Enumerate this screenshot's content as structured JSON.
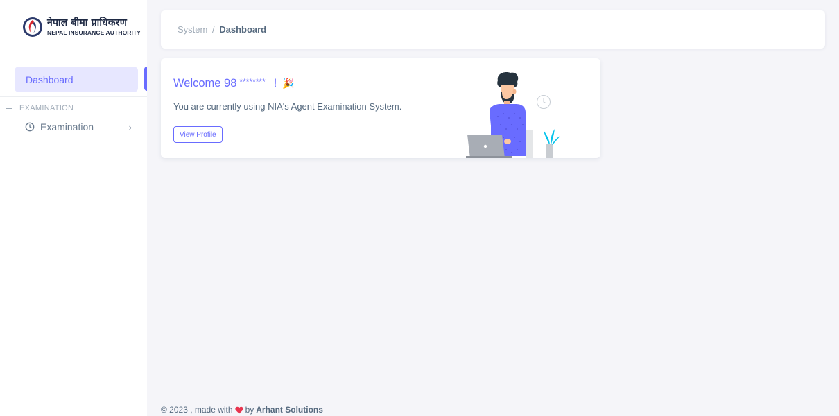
{
  "brand": {
    "name_devanagari": "नेपाल बीमा प्राधिकरण",
    "name_english": "NEPAL INSURANCE AUTHORITY"
  },
  "sidebar": {
    "active_item": "Dashboard",
    "section_header": "EXAMINATION",
    "items": [
      {
        "label": "Examination",
        "icon": "clock-icon"
      }
    ]
  },
  "breadcrumb": {
    "parent": "System",
    "separator": "/",
    "current": "Dashboard"
  },
  "welcome_card": {
    "greeting": "Welcome 98",
    "masked": "********",
    "exclaim": "!",
    "emoji": "🎉",
    "message": "You are currently using NIA's Agent Examination System.",
    "button_label": "View Profile"
  },
  "footer": {
    "copyright": "© 2023 , made with",
    "by": "by",
    "company": "Arhant Solutions"
  },
  "colors": {
    "accent": "#696cff",
    "accent_light": "#e7e7ff",
    "heart": "#e8344e"
  }
}
